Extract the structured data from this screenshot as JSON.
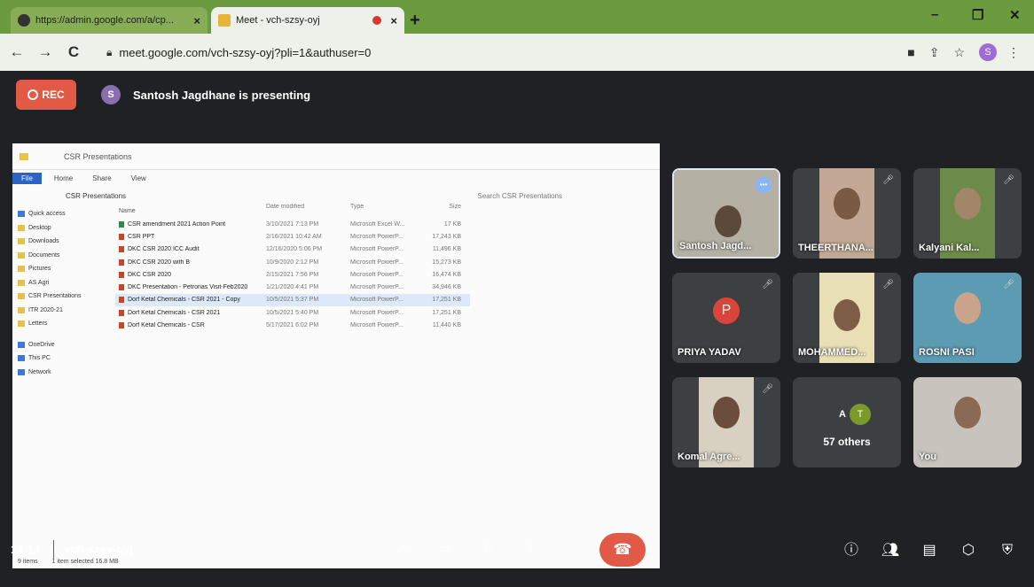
{
  "browser": {
    "tabs": [
      {
        "title": "https://admin.google.com/a/cp...",
        "close": "×"
      },
      {
        "title": "Meet - vch-szsy-oyj",
        "close": "×"
      }
    ],
    "new_tab": "+",
    "window_controls": {
      "minimize": "–",
      "maximize": "❐",
      "close": "✕"
    },
    "url": "meet.google.com/vch-szsy-oyj?pli=1&authuser=0",
    "profile_initial": "S"
  },
  "meet": {
    "rec_label": "REC",
    "presenter_initial": "S",
    "presenter_text": "Santosh Jagdhane is presenting",
    "time": "14:14",
    "meeting_code": "vch-szsy-oyj",
    "others_count": "57 others",
    "others_avatar_1": "A",
    "others_avatar_2": "T",
    "participants": [
      {
        "name": "Santosh Jagd...",
        "speaking": true
      },
      {
        "name": "THEERTHANA..."
      },
      {
        "name": "Kalyani Kal..."
      },
      {
        "name": "PRIYA YADAV",
        "initial": "P"
      },
      {
        "name": "MOHAMMED..."
      },
      {
        "name": "ROSNI PASI"
      },
      {
        "name": "Komal Agre..."
      },
      {
        "name": "You"
      }
    ]
  },
  "shared_screen": {
    "window_title": "CSR Presentations",
    "ribbon": {
      "file": "File",
      "home": "Home",
      "share": "Share",
      "view": "View"
    },
    "path": "CSR Presentations",
    "search_placeholder": "Search CSR Presentations",
    "columns": [
      "Name",
      "Date modified",
      "Type",
      "Size"
    ],
    "nav": [
      "Quick access",
      "Desktop",
      "Downloads",
      "Documents",
      "Pictures",
      "AS Agri",
      "CSR Presentations",
      "ITR 2020-21",
      "Letters",
      "OneDrive",
      "This PC",
      "Network"
    ],
    "files": [
      {
        "name": "CSR amendment 2021 Action Point",
        "date": "3/10/2021 7:13 PM",
        "type": "Microsoft Excel W...",
        "size": "17 KB"
      },
      {
        "name": "CSR PPT",
        "date": "2/16/2021 10:42 AM",
        "type": "Microsoft PowerP...",
        "size": "17,243 KB"
      },
      {
        "name": "DKC CSR 2020 ICC Audit",
        "date": "12/16/2020 5:06 PM",
        "type": "Microsoft PowerP...",
        "size": "11,496 KB"
      },
      {
        "name": "DKC CSR 2020 with B",
        "date": "10/9/2020 2:12 PM",
        "type": "Microsoft PowerP...",
        "size": "15,273 KB"
      },
      {
        "name": "DKC CSR 2020",
        "date": "2/15/2021 7:56 PM",
        "type": "Microsoft PowerP...",
        "size": "16,474 KB"
      },
      {
        "name": "DKC Presentation - Petronas Visit-Feb2020",
        "date": "1/21/2020 4:41 PM",
        "type": "Microsoft PowerP...",
        "size": "34,946 KB"
      },
      {
        "name": "Dorf Ketal Chemicals - CSR 2021 - Copy",
        "date": "10/5/2021 5:37 PM",
        "type": "Microsoft PowerP...",
        "size": "17,251 KB"
      },
      {
        "name": "Dorf Ketal Chemicals - CSR 2021",
        "date": "10/5/2021 5:40 PM",
        "type": "Microsoft PowerP...",
        "size": "17,251 KB"
      },
      {
        "name": "Dorf Ketal Chemicals - CSR",
        "date": "5/17/2021 6:02 PM",
        "type": "Microsoft PowerP...",
        "size": "11,440 KB"
      }
    ],
    "status_items": "9 items",
    "status_selected": "1 item selected 16.8 MB"
  },
  "colors": {
    "rec": "#e25a45",
    "tab_strip": "#6c9a3e",
    "meet_bg": "#202124"
  }
}
